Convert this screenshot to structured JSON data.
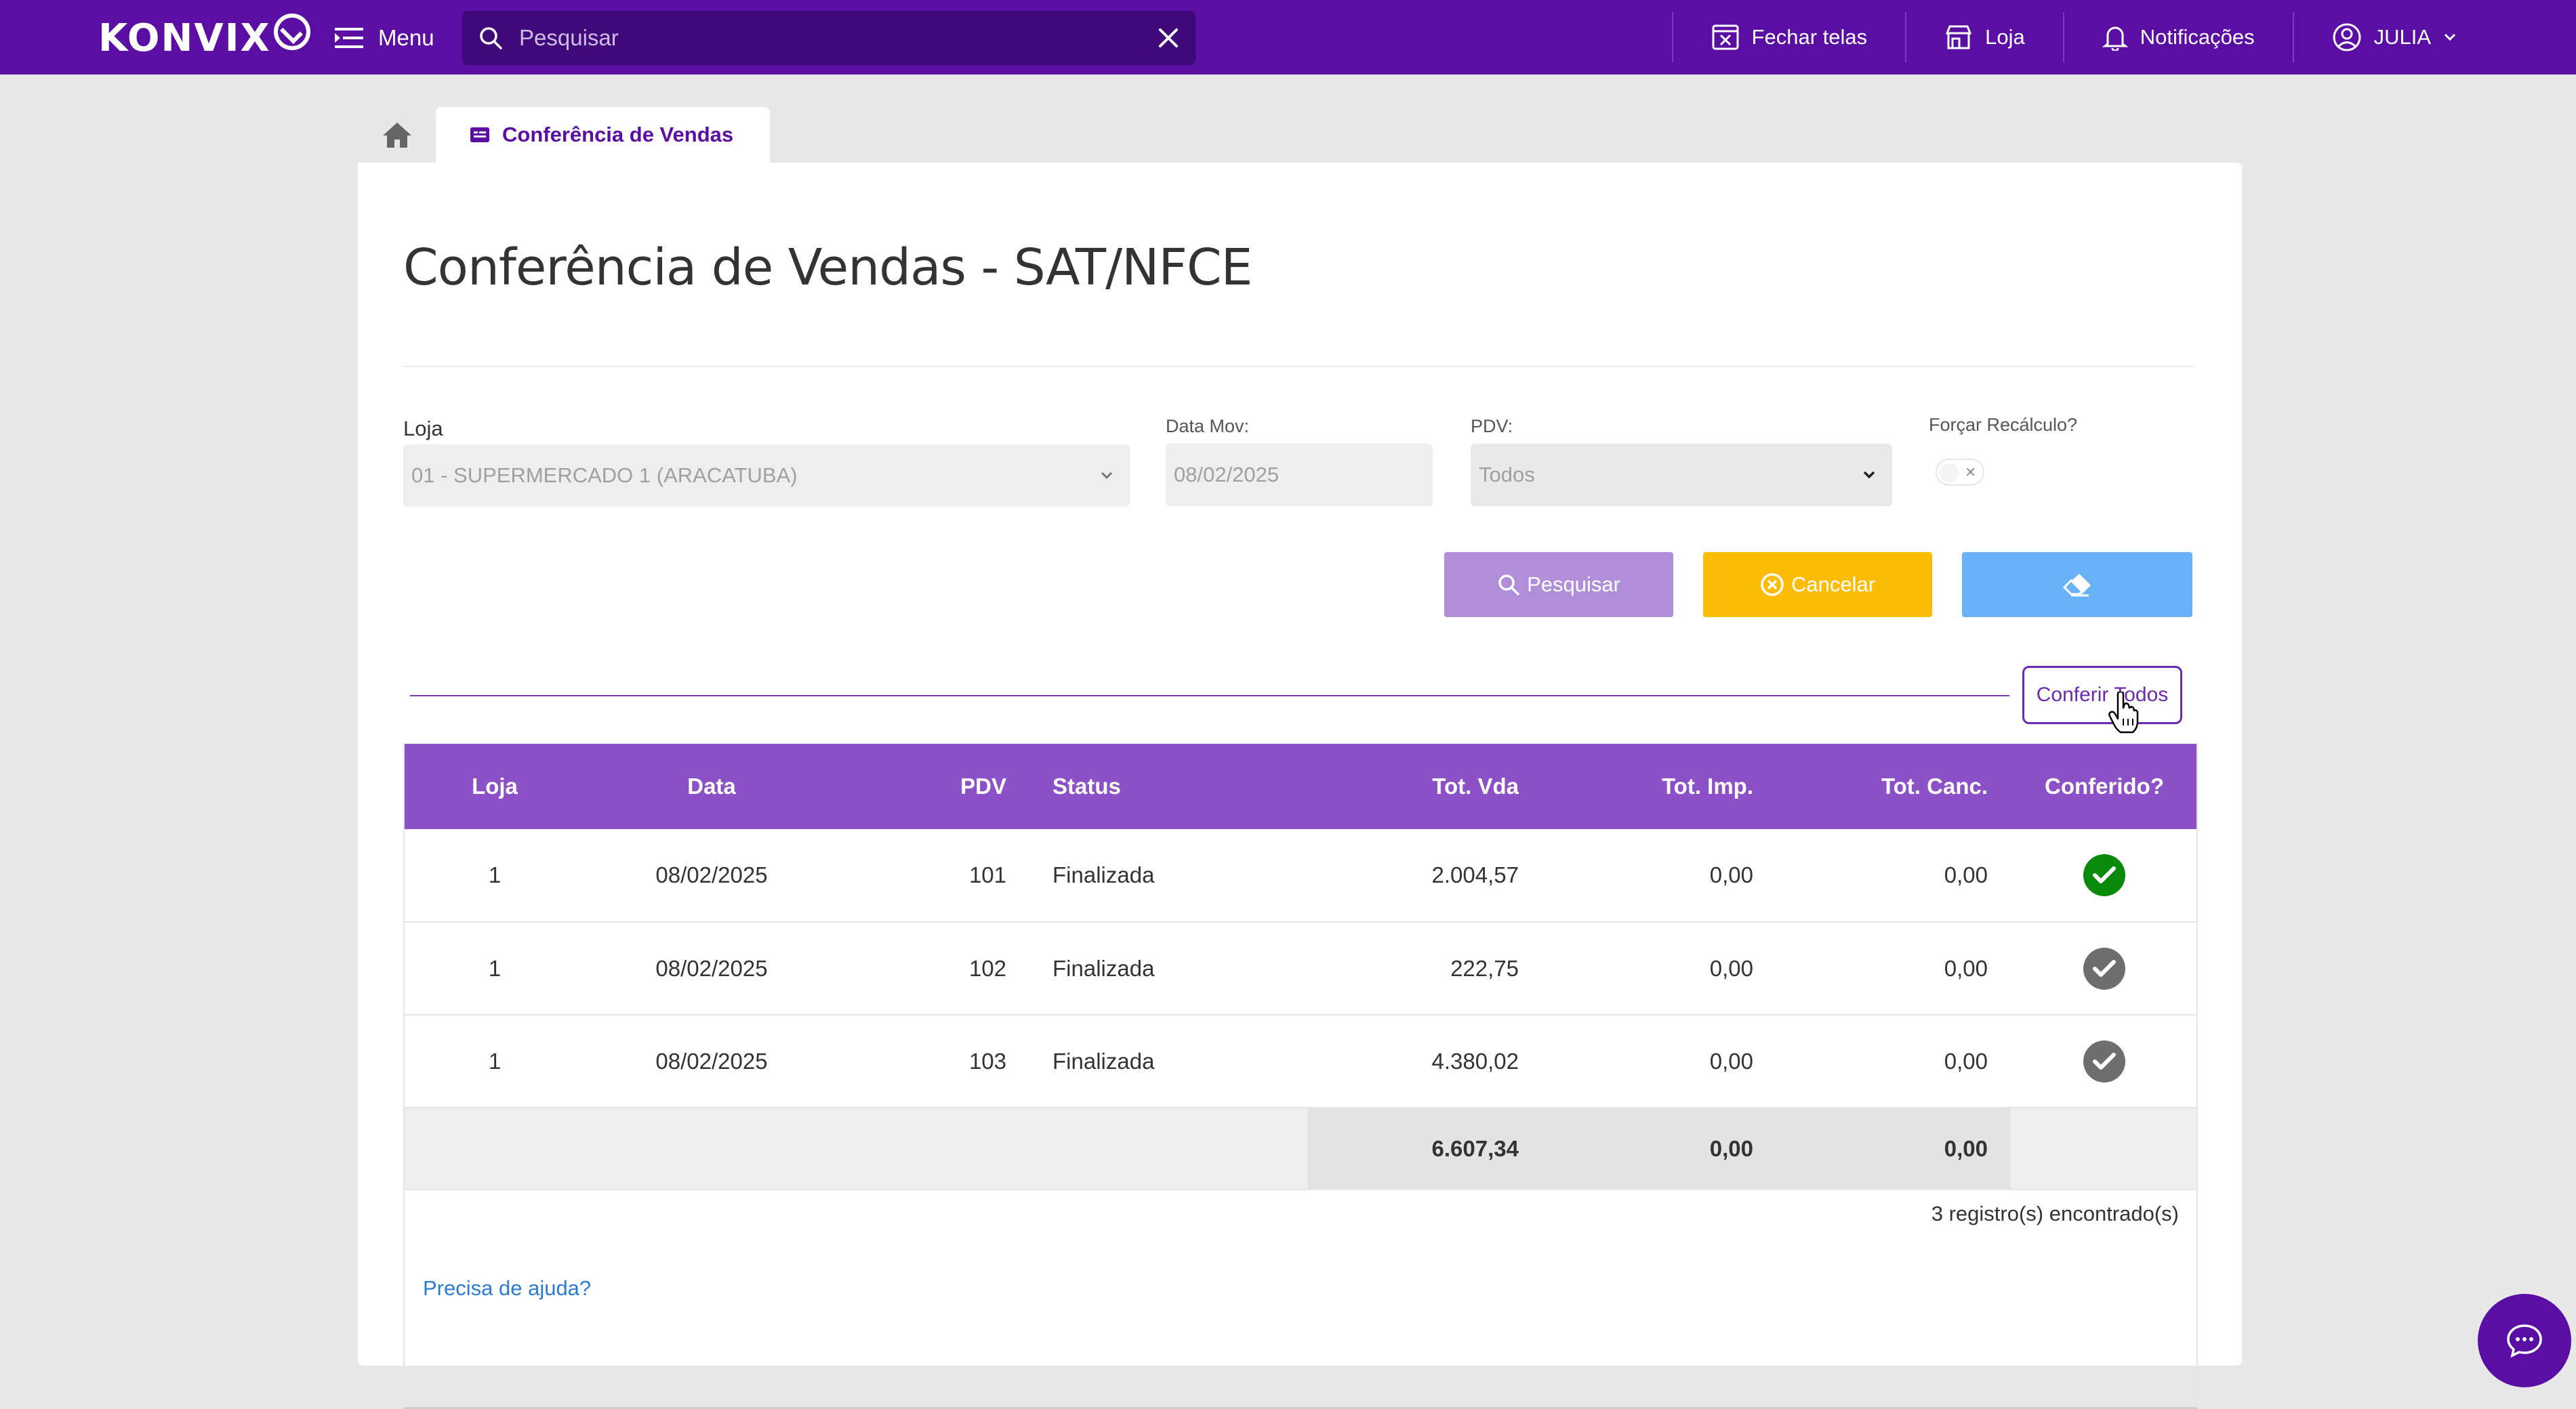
{
  "header": {
    "brand": "KONVIX",
    "menu_label": "Menu",
    "search_placeholder": "Pesquisar",
    "actions": {
      "close_screens": "Fechar telas",
      "store": "Loja",
      "notifications": "Notificações",
      "user": "JULIA"
    }
  },
  "tabs": {
    "active_label": "Conferência de Vendas"
  },
  "page": {
    "title": "Conferência de Vendas - SAT/NFCE"
  },
  "filters": {
    "loja_label": "Loja",
    "loja_value": "01 - SUPERMERCADO 1 (ARACATUBA)",
    "data_label": "Data Mov:",
    "data_value": "08/02/2025",
    "pdv_label": "PDV:",
    "pdv_value": "Todos",
    "recalc_label": "Forçar Recálculo?",
    "recalc_on": false
  },
  "buttons": {
    "search": "Pesquisar",
    "cancel": "Cancelar",
    "conferir_todos": "Conferir Todos"
  },
  "colors": {
    "brand": "#5b0ea3",
    "table_header": "#8c51c7",
    "search_btn": "#b08fd8",
    "cancel_btn": "#fbbd08",
    "clear_btn": "#6ab2f8",
    "check_green": "#0a8a0a",
    "check_gray": "#6e6e6e"
  },
  "table": {
    "columns": [
      "Loja",
      "Data",
      "PDV",
      "Status",
      "Tot. Vda",
      "Tot. Imp.",
      "Tot. Canc.",
      "Conferido?"
    ],
    "rows": [
      {
        "loja": "1",
        "data": "08/02/2025",
        "pdv": "101",
        "status": "Finalizada",
        "tot_vda": "2.004,57",
        "tot_imp": "0,00",
        "tot_canc": "0,00",
        "conferido": true
      },
      {
        "loja": "1",
        "data": "08/02/2025",
        "pdv": "102",
        "status": "Finalizada",
        "tot_vda": "222,75",
        "tot_imp": "0,00",
        "tot_canc": "0,00",
        "conferido": false
      },
      {
        "loja": "1",
        "data": "08/02/2025",
        "pdv": "103",
        "status": "Finalizada",
        "tot_vda": "4.380,02",
        "tot_imp": "0,00",
        "tot_canc": "0,00",
        "conferido": false
      }
    ],
    "totals": {
      "tot_vda": "6.607,34",
      "tot_imp": "0,00",
      "tot_canc": "0,00"
    },
    "record_count": "3 registro(s) encontrado(s)"
  },
  "help_link": "Precisa de ajuda?"
}
